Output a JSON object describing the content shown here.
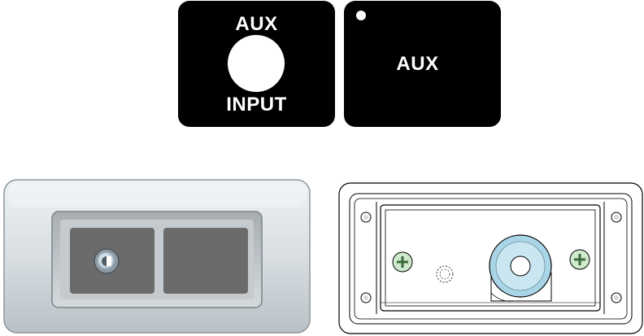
{
  "labels": {
    "left": {
      "top": "AUX",
      "bottom": "INPUT",
      "icon": "jack-hole"
    },
    "right": {
      "text": "AUX",
      "icon": "indicator-dot"
    }
  },
  "renders": {
    "front": {
      "icon": "panel-front-render"
    },
    "back": {
      "icon": "panel-back-render"
    }
  },
  "colors": {
    "label_bg": "#000000",
    "label_fg": "#ffffff",
    "faceplate": "#d6dde1",
    "window": "#6b6b6b",
    "bushing": "#a9d5e6"
  }
}
